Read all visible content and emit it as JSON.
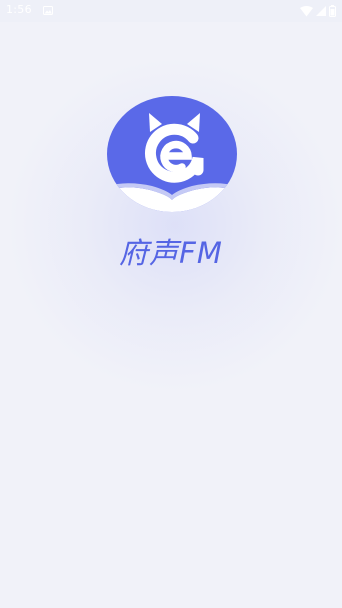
{
  "status_bar": {
    "time": "1:56",
    "icons": [
      "gallery-icon",
      "wifi-icon",
      "cell-signal-icon",
      "battery-icon"
    ]
  },
  "splash": {
    "app_name": "府声FM",
    "logo_icon": "cat-logo-icon"
  },
  "colors": {
    "brand": "#5565e4",
    "background": "#f1f2f9",
    "logo_circle": "#5a69e8",
    "white": "#ffffff"
  }
}
